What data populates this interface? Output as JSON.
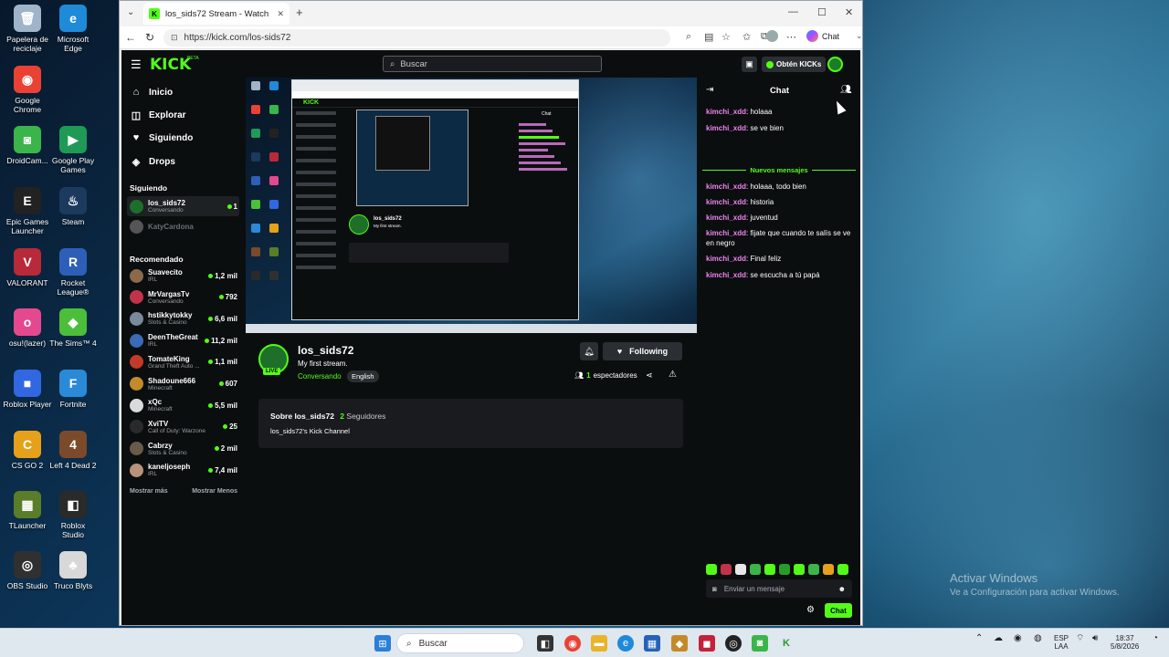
{
  "desktop": {
    "icons": [
      {
        "label": "Papelera de\nreciclaje",
        "color": "#9fb4c8",
        "glyph": "🗑"
      },
      {
        "label": "Microsoft\nEdge",
        "color": "#1f8ad8",
        "glyph": "e"
      },
      {
        "label": "Google\nChrome",
        "color": "#e94235",
        "glyph": "◉"
      },
      {
        "label": "DroidCam...",
        "color": "#3bb54a",
        "glyph": "◙"
      },
      {
        "label": "Google Play\nGames",
        "color": "#1e9a56",
        "glyph": "▶"
      },
      {
        "label": "Epic Games\nLauncher",
        "color": "#222222",
        "glyph": "E"
      },
      {
        "label": "Steam",
        "color": "#1b3a5e",
        "glyph": "♨"
      },
      {
        "label": "VALORANT",
        "color": "#b8293a",
        "glyph": "V"
      },
      {
        "label": "Rocket\nLeague®",
        "color": "#2d5fb8",
        "glyph": "R"
      },
      {
        "label": "osu!(lazer)",
        "color": "#e4498f",
        "glyph": "o"
      },
      {
        "label": "The Sims™ 4",
        "color": "#4bbf3a",
        "glyph": "◆"
      },
      {
        "label": "Roblox Player",
        "color": "#3167e0",
        "glyph": "■"
      },
      {
        "label": "Fortnite",
        "color": "#2a8ad8",
        "glyph": "F"
      },
      {
        "label": "CS GO 2",
        "color": "#e6a11a",
        "glyph": "C"
      },
      {
        "label": "Left 4 Dead 2",
        "color": "#7a4a2a",
        "glyph": "4"
      },
      {
        "label": "TLauncher",
        "color": "#5a7d2a",
        "glyph": "▦"
      },
      {
        "label": "Roblox\nStudio",
        "color": "#2a2a2a",
        "glyph": "◧"
      },
      {
        "label": "OBS Studio",
        "color": "#303030",
        "glyph": "◎"
      },
      {
        "label": "Truco Blyts",
        "color": "#d8d8d8",
        "glyph": "♣"
      }
    ],
    "watermark_title": "Activar Windows",
    "watermark_sub": "Ve a Configuración para activar Windows."
  },
  "taskbar": {
    "search_placeholder": "Buscar",
    "lang": "ESP\nLAA",
    "time": "18:37",
    "date": "5/8/2026"
  },
  "browser": {
    "tab_title": "los_sids72 Stream - Watch Li",
    "url": "https://kick.com/los-sids72",
    "copilot_label": "Chat"
  },
  "kick": {
    "logo": "KICK",
    "beta": "BETA",
    "search_placeholder": "Buscar",
    "get_kicks": "Obtén KICKs",
    "nav": [
      {
        "label": "Inicio",
        "icon": "⌂"
      },
      {
        "label": "Explorar",
        "icon": "◫"
      },
      {
        "label": "Siguiendo",
        "icon": "♥"
      },
      {
        "label": "Drops",
        "icon": "◈"
      }
    ],
    "following_title": "Siguiendo",
    "following": [
      {
        "name": "los_sids72",
        "category": "Conversando",
        "viewers": "1",
        "color": "#1d6f2a",
        "live": true
      },
      {
        "name": "KatyCardona",
        "category": "",
        "viewers": "",
        "color": "#555555",
        "live": false
      }
    ],
    "recommended_title": "Recomendado",
    "recommended": [
      {
        "name": "Suavecito",
        "category": "IRL",
        "viewers": "1,2 mil",
        "color": "#8a6a4a"
      },
      {
        "name": "MrVargasTv",
        "category": "Conversando",
        "viewers": "792",
        "color": "#c2334a"
      },
      {
        "name": "hstikkytokky",
        "category": "Slots & Casino",
        "viewers": "6,6 mil",
        "color": "#7a8a9a"
      },
      {
        "name": "DeenTheGreat",
        "category": "IRL",
        "viewers": "11,2 mil",
        "color": "#3a6ab8"
      },
      {
        "name": "TomateKing",
        "category": "Grand Theft Auto ...",
        "viewers": "1,1 mil",
        "color": "#c23a2a"
      },
      {
        "name": "Shadoune666",
        "category": "Minecraft",
        "viewers": "607",
        "color": "#c28a2a"
      },
      {
        "name": "xQc",
        "category": "Minecraft",
        "viewers": "5,5 mil",
        "color": "#dadada"
      },
      {
        "name": "XviTV",
        "category": "Call of Duty: Warzone",
        "viewers": "25",
        "color": "#2a2a2a"
      },
      {
        "name": "Cabrzy",
        "category": "Slots & Casino",
        "viewers": "2 mil",
        "color": "#6a5a4a"
      },
      {
        "name": "kaneljoseph",
        "category": "IRL",
        "viewers": "7,4 mil",
        "color": "#b8927a"
      }
    ],
    "show_more": "Mostrar más",
    "show_less": "Mostrar Menos",
    "stream": {
      "name": "los_sids72",
      "title": "My first stream.",
      "category": "Conversando",
      "tag": "English",
      "live": "LIVE",
      "follow_label": "Following",
      "viewers_count": "1",
      "viewers_label": "espectadores"
    },
    "about": {
      "title": "Sobre los_sids72",
      "followers_count": "2",
      "followers_label": "Seguidores",
      "description": "los_sids72's Kick Channel"
    },
    "chat": {
      "title": "Chat",
      "messages_before": [
        {
          "user": "kimchi_xdd",
          "text": "holaaa"
        },
        {
          "user": "kimchi_xdd",
          "text": "se ve bien"
        }
      ],
      "new_messages": "Nuevos mensajes",
      "messages_after": [
        {
          "user": "kimchi_xdd",
          "text": "holaaa, todo bien"
        },
        {
          "user": "kimchi_xdd",
          "text": "historia"
        },
        {
          "user": "kimchi_xdd",
          "text": "juventud"
        },
        {
          "user": "kimchi_xdd",
          "text": "fijate que cuando te salís se ve en negro"
        },
        {
          "user": "kimchi_xdd",
          "text": "Final feliz"
        },
        {
          "user": "kimchi_xdd",
          "text": "se escucha a tú papá"
        }
      ],
      "input_placeholder": "Enviar un mensaje",
      "send_label": "Chat"
    }
  }
}
